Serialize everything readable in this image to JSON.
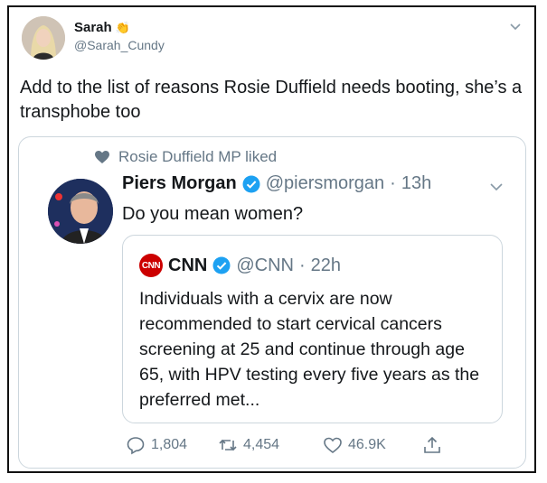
{
  "tweet": {
    "author_name": "Sarah",
    "author_emoji": "👏",
    "author_handle": "@Sarah_Cundy",
    "text": "Add to the list of reasons Rosie Duffield needs booting, she’s a transphobe too"
  },
  "quote": {
    "liked_by": "Rosie Duffield MP liked",
    "author_name": "Piers Morgan",
    "author_handle": "@piersmorgan",
    "time": "13h",
    "text": "Do you mean women?",
    "inner": {
      "logo_text": "CNN",
      "author_name": "CNN",
      "author_handle": "@CNN",
      "time": "22h",
      "text": "Individuals with a cervix are now recommended to start cervical cancers screening at 25 and continue through age 65, with HPV testing every five years as the preferred met..."
    },
    "actions": {
      "replies": "1,804",
      "retweets": "4,454",
      "likes": "46.9K"
    }
  },
  "icons": {
    "verified": "verified-badge-icon",
    "reply": "reply-icon",
    "retweet": "retweet-icon",
    "like": "heart-icon",
    "share": "share-icon",
    "caret": "chevron-down-icon"
  },
  "colors": {
    "verified": "#1da1f2",
    "muted": "#657786",
    "border": "#ccd6dd",
    "cnn_red": "#cc0000"
  }
}
